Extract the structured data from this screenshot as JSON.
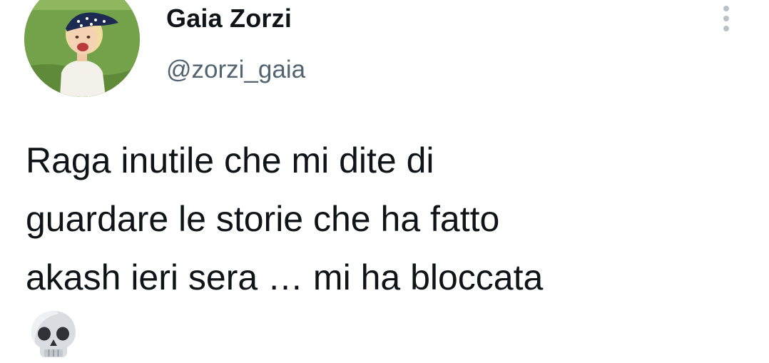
{
  "author": {
    "display_name": "Gaia Zorzi",
    "handle": "@zorzi_gaia",
    "avatar": "profile-photo-child-with-bandana"
  },
  "header": {
    "more_icon": "vertical-ellipsis-icon"
  },
  "tweet": {
    "lines": [
      "Raga inutile che mi dite di",
      "guardare le storie che ha fatto",
      "akash ieri sera … mi ha bloccata"
    ],
    "emoji": "💀",
    "emoji_icon": "skull-emoji-icon"
  },
  "colors": {
    "text_primary": "#0f1419",
    "text_secondary": "#536471",
    "more_icon": "#b9c1c9",
    "background": "#ffffff"
  }
}
